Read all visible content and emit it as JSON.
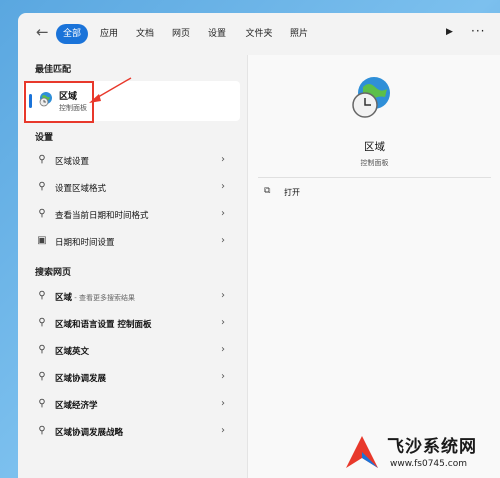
{
  "tabs": {
    "back_glyph": "←",
    "items": [
      "全部",
      "应用",
      "文档",
      "网页",
      "设置",
      "文件夹",
      "照片"
    ],
    "active": "全部",
    "play_glyph": "▶",
    "more_glyph": "···"
  },
  "best_match": {
    "header": "最佳匹配",
    "title": "区域",
    "subtitle": "控制面板"
  },
  "settings": {
    "header": "设置",
    "items": [
      "区域设置",
      "设置区域格式",
      "查看当前日期和时间格式",
      "日期和时间设置"
    ]
  },
  "web": {
    "header": "搜索网页",
    "items": [
      {
        "bold": "区域",
        "rest": " - 查看更多搜索结果"
      },
      {
        "bold": "区域和语言设置 控制面板",
        "rest": ""
      },
      {
        "bold": "区域英文",
        "rest": ""
      },
      {
        "bold": "区域协调发展",
        "rest": ""
      },
      {
        "bold": "区域经济学",
        "rest": ""
      },
      {
        "bold": "区域协调发展战略",
        "rest": ""
      }
    ]
  },
  "detail": {
    "title": "区域",
    "subtitle": "控制面板",
    "open_label": "打开",
    "open_icon": "open-external-icon"
  },
  "watermark": {
    "name": "飞沙系统网",
    "url": "www.fs0745.com"
  },
  "colors": {
    "accent": "#1a73d9",
    "highlight": "#e8382b"
  }
}
